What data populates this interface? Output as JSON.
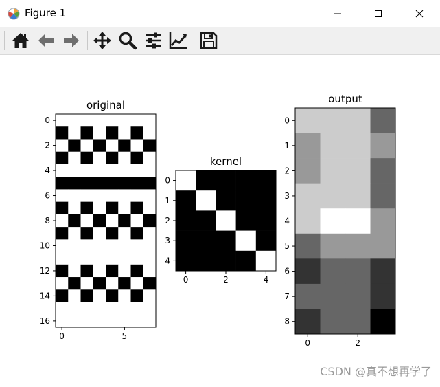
{
  "window": {
    "title": "Figure 1"
  },
  "toolbar": {
    "buttons": [
      "home-icon",
      "back-arrow-icon",
      "forward-arrow-icon",
      "pan-icon",
      "zoom-icon",
      "subplots-config-icon",
      "edit-axes-icon",
      "save-icon"
    ]
  },
  "colors": {
    "toolbar_bg": "#f0f0f0",
    "icon": "#1a1a1a"
  },
  "chart_data": [
    {
      "type": "heatmap",
      "title": "original",
      "cmap": "gray",
      "x_ticks": [
        "0",
        "5"
      ],
      "y_ticks": [
        "0",
        "2",
        "4",
        "6",
        "8",
        "10",
        "12",
        "14",
        "16"
      ],
      "values": [
        [
          1,
          1,
          1,
          1,
          1,
          1,
          1,
          1
        ],
        [
          0,
          1,
          0,
          1,
          0,
          1,
          0,
          1
        ],
        [
          1,
          0,
          1,
          0,
          1,
          0,
          1,
          0
        ],
        [
          0,
          1,
          0,
          1,
          0,
          1,
          0,
          1
        ],
        [
          1,
          1,
          1,
          1,
          1,
          1,
          1,
          1
        ],
        [
          0,
          0,
          0,
          0,
          0,
          0,
          0,
          0
        ],
        [
          1,
          1,
          1,
          1,
          1,
          1,
          1,
          1
        ],
        [
          0,
          1,
          0,
          1,
          0,
          1,
          0,
          1
        ],
        [
          1,
          0,
          1,
          0,
          1,
          0,
          1,
          0
        ],
        [
          0,
          1,
          0,
          1,
          0,
          1,
          0,
          1
        ],
        [
          1,
          1,
          1,
          1,
          1,
          1,
          1,
          1
        ],
        [
          1,
          1,
          1,
          1,
          1,
          1,
          1,
          1
        ],
        [
          0,
          1,
          0,
          1,
          0,
          1,
          0,
          1
        ],
        [
          1,
          0,
          1,
          0,
          1,
          0,
          1,
          0
        ],
        [
          0,
          1,
          0,
          1,
          0,
          1,
          0,
          1
        ],
        [
          1,
          1,
          1,
          1,
          1,
          1,
          1,
          1
        ],
        [
          1,
          1,
          1,
          1,
          1,
          1,
          1,
          1
        ]
      ]
    },
    {
      "type": "heatmap",
      "title": "kernel",
      "cmap": "gray",
      "x_ticks": [
        "0",
        "2",
        "4"
      ],
      "y_ticks": [
        "0",
        "1",
        "2",
        "3",
        "4"
      ],
      "values": [
        [
          1,
          0,
          0,
          0,
          0
        ],
        [
          0,
          1,
          0,
          0,
          0
        ],
        [
          0,
          0,
          1,
          0,
          0
        ],
        [
          0,
          0,
          0,
          1,
          0
        ],
        [
          0,
          0,
          0,
          0,
          1
        ]
      ]
    },
    {
      "type": "heatmap",
      "title": "output",
      "cmap": "gray",
      "x_ticks": [
        "0",
        "2"
      ],
      "y_ticks": [
        "0",
        "1",
        "2",
        "3",
        "4",
        "5",
        "6",
        "7",
        "8"
      ],
      "values": [
        [
          0.8,
          0.8,
          0.8,
          0.4
        ],
        [
          0.6,
          0.8,
          0.8,
          0.6
        ],
        [
          0.6,
          0.8,
          0.8,
          0.4
        ],
        [
          0.8,
          0.8,
          0.8,
          0.4
        ],
        [
          0.8,
          1.0,
          1.0,
          0.6
        ],
        [
          0.4,
          0.6,
          0.6,
          0.6
        ],
        [
          0.2,
          0.4,
          0.4,
          0.2
        ],
        [
          0.4,
          0.4,
          0.4,
          0.2
        ],
        [
          0.2,
          0.4,
          0.4,
          0.0
        ]
      ]
    }
  ],
  "watermark": "CSDN @真不想再学了"
}
